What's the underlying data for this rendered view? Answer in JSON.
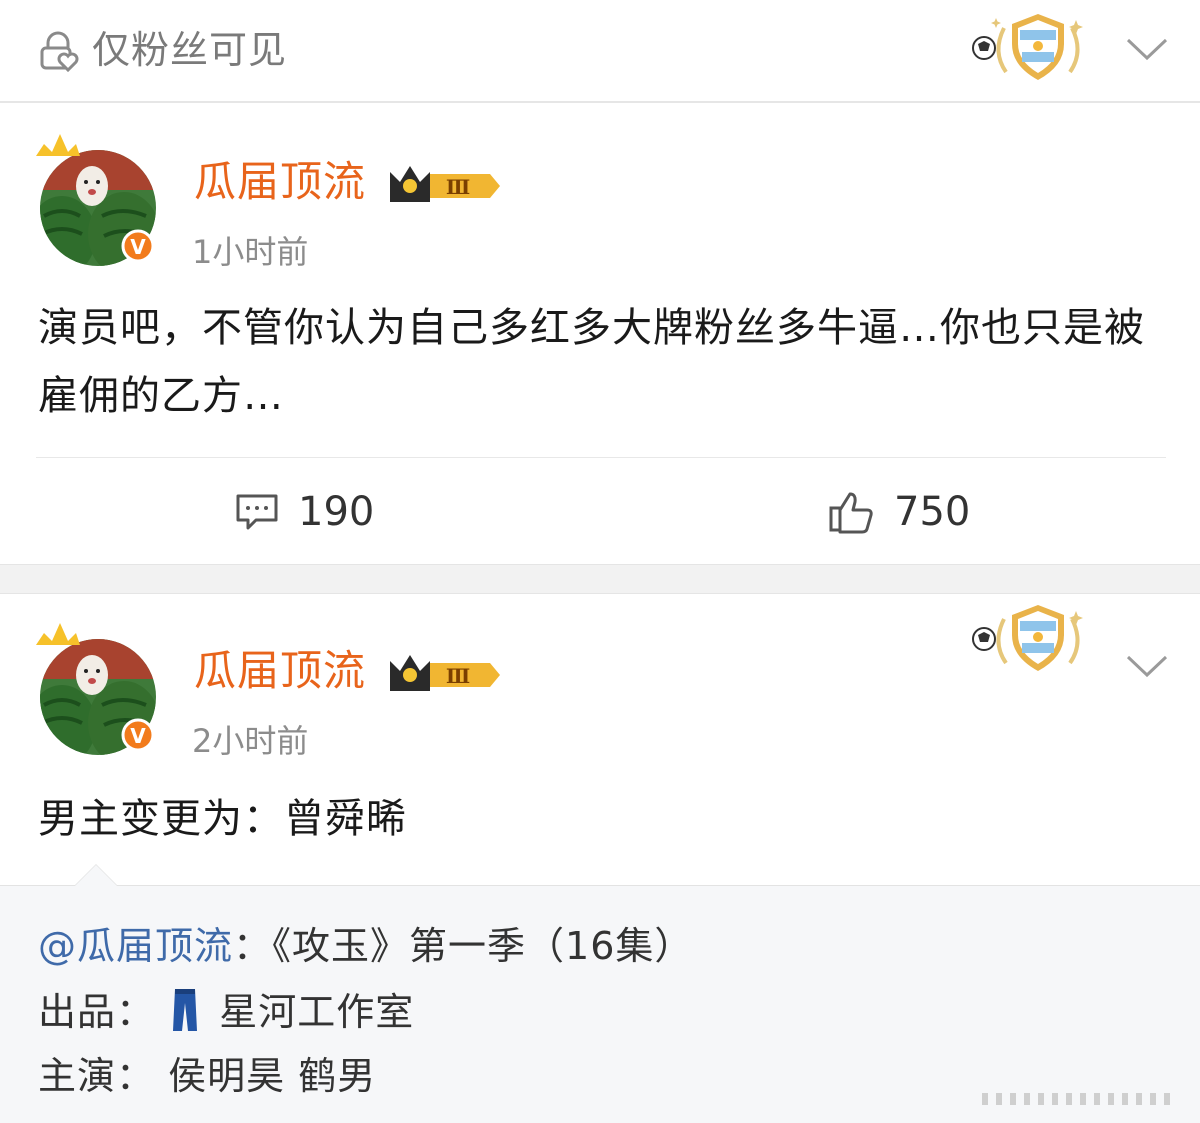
{
  "topbar": {
    "visibility_label": "仅粉丝可见",
    "icons": {
      "lock": "lock-heart-icon",
      "badge": "argentina-shield-badge-icon",
      "expand": "chevron-down-icon"
    }
  },
  "posts": [
    {
      "username": "瓜届顶流",
      "rank_badge": "Ⅲ",
      "verified": "V",
      "time": "1小时前",
      "text": "演员吧，不管你认为自己多红多大牌粉丝多牛逼…你也只是被雇佣的乙方…",
      "comments": "190",
      "likes": "750"
    },
    {
      "username": "瓜届顶流",
      "rank_badge": "Ⅲ",
      "verified": "V",
      "time": "2小时前",
      "text": "男主变更为：曾舜晞"
    }
  ],
  "quote": {
    "mention": "@瓜届顶流",
    "title_rest": "：《攻玉》第一季（16集）",
    "producer_label": "出品：",
    "producer": "星河工作室",
    "cast_label": "主演：",
    "cast": "侯明昊 鹤男"
  },
  "colors": {
    "username": "#e8641b",
    "mention": "#3f6aa9",
    "muted": "#8c8c8c"
  }
}
